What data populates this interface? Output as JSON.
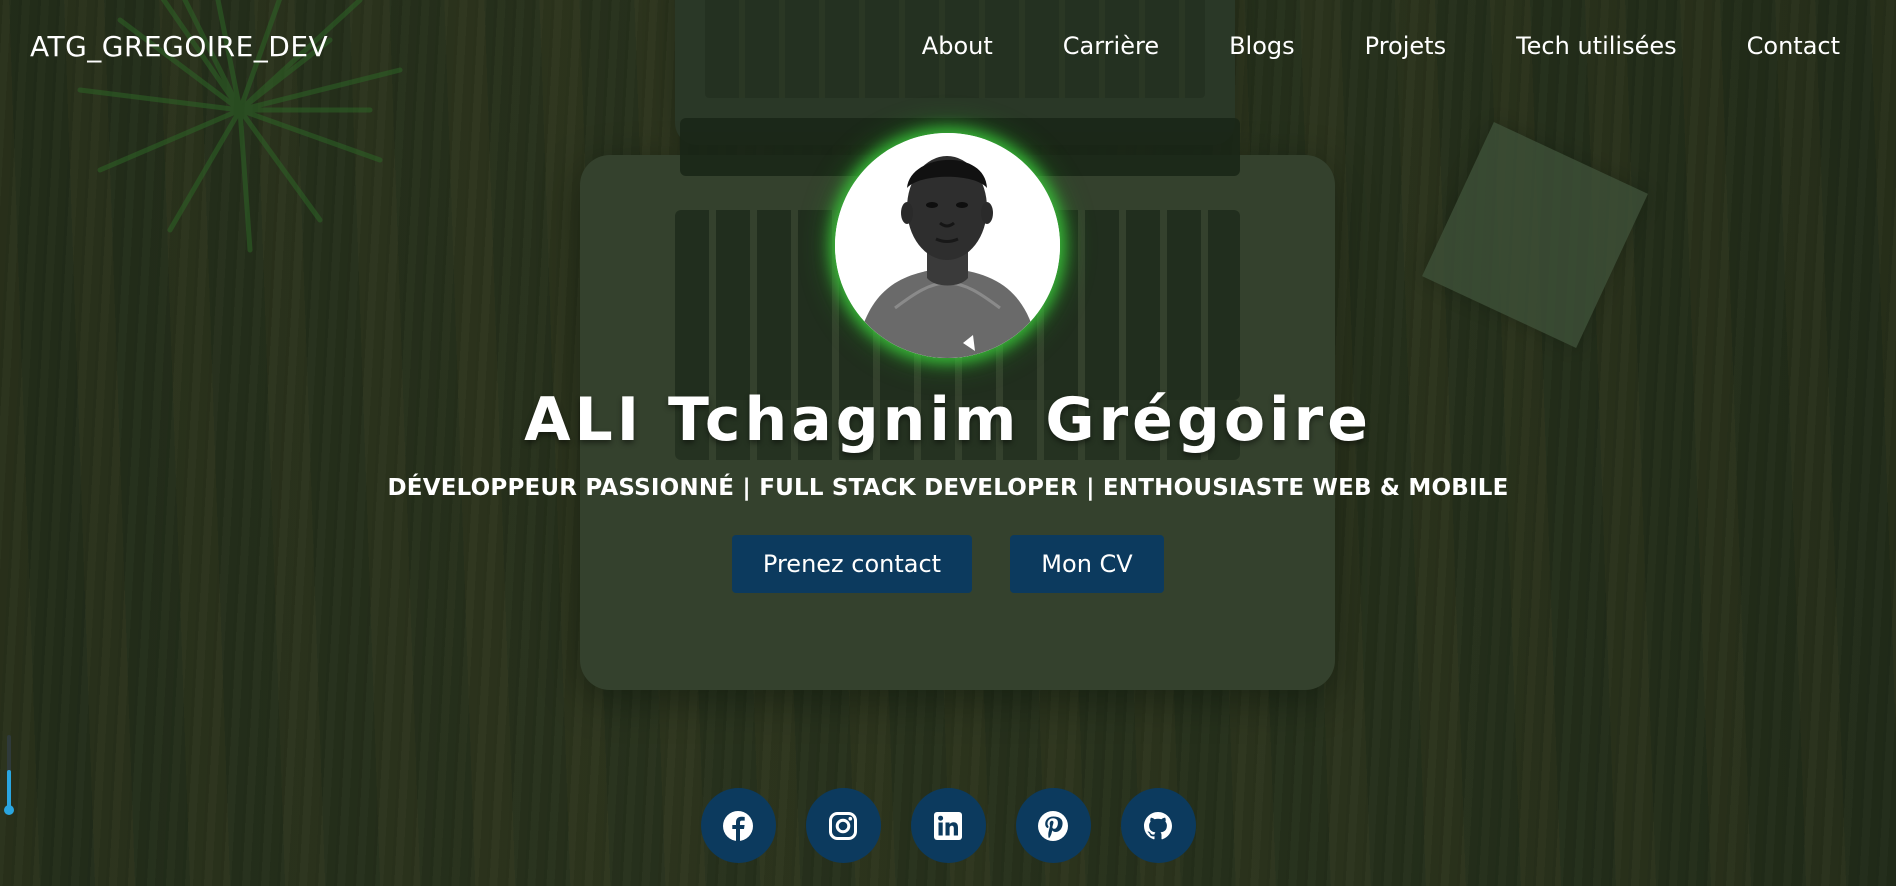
{
  "brand": "ATG_GREGOIRE_DEV",
  "nav": [
    {
      "label": "About"
    },
    {
      "label": "Carrière"
    },
    {
      "label": "Blogs"
    },
    {
      "label": "Projets"
    },
    {
      "label": "Tech utilisées"
    },
    {
      "label": "Contact"
    }
  ],
  "hero": {
    "name": "ALI Tchagnim Grégoire",
    "subtitle": "DÉVELOPPEUR PASSIONNÉ | FULL STACK DEVELOPER | ENTHOUSIASTE WEB & MOBILE",
    "buttons": {
      "contact": "Prenez contact",
      "cv": "Mon CV"
    }
  },
  "socials": [
    {
      "icon": "facebook-icon"
    },
    {
      "icon": "instagram-icon"
    },
    {
      "icon": "linkedin-icon"
    },
    {
      "icon": "pinterest-icon"
    },
    {
      "icon": "github-icon"
    }
  ],
  "scroll_progress": 0.55,
  "colors": {
    "button_bg": "#0c3a5e",
    "avatar_glow": "#3cc83c",
    "scroll_accent": "#2aa6e0",
    "text": "#ffffff"
  }
}
